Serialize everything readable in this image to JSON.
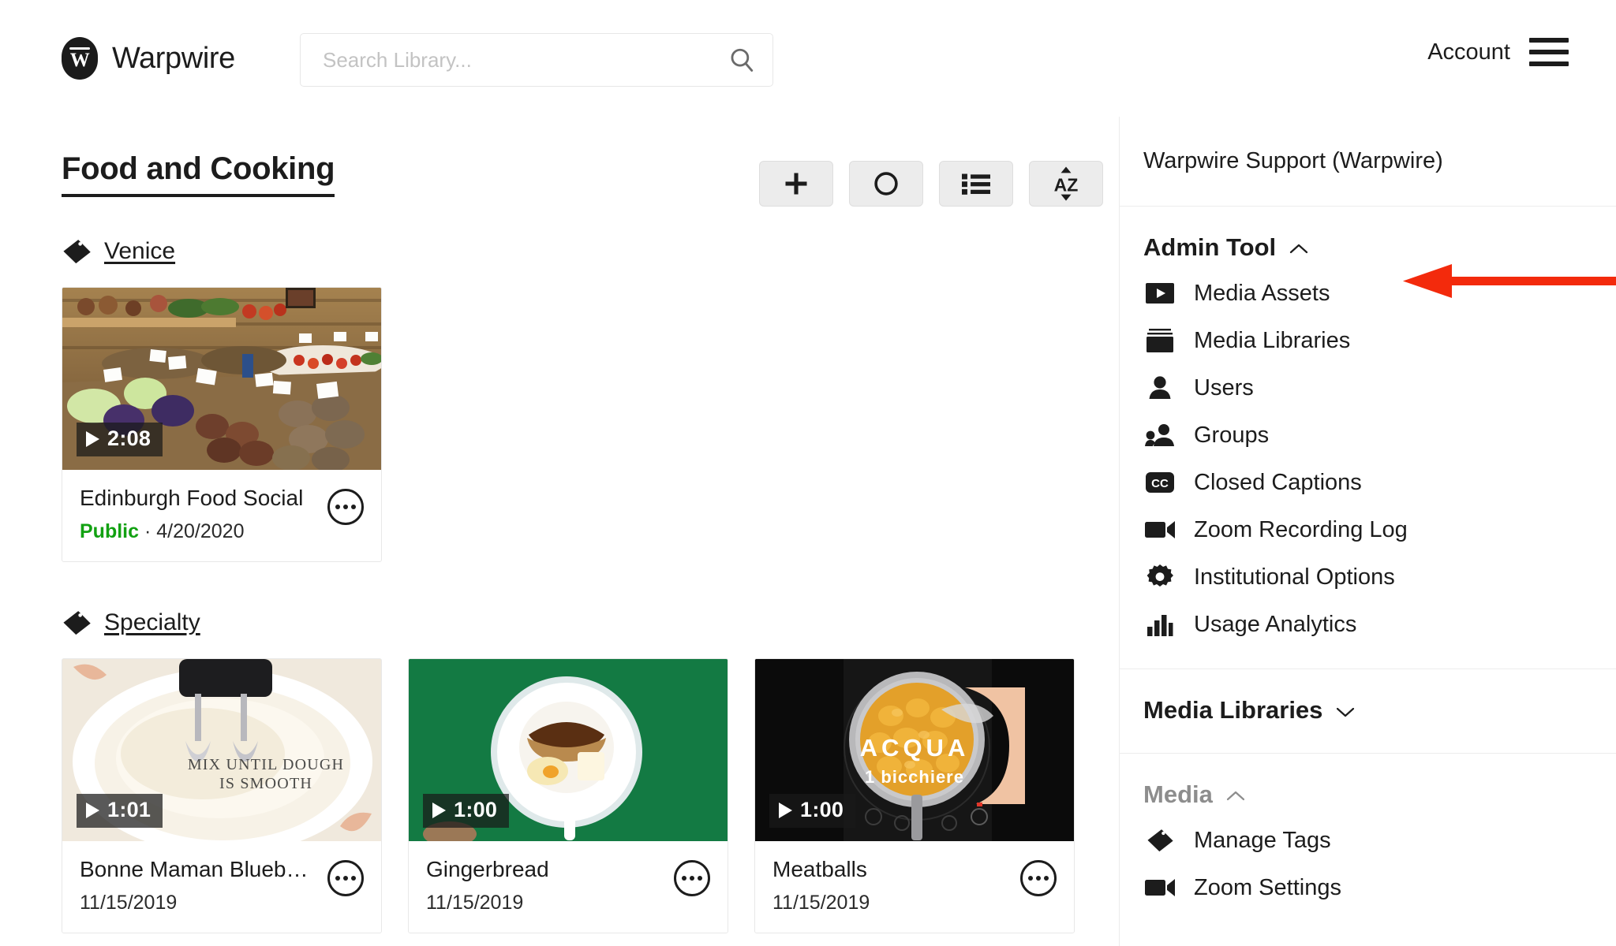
{
  "header": {
    "brand_name": "Warpwire",
    "brand_mark": "W",
    "search": {
      "value": "",
      "placeholder": "Search Library..."
    },
    "account_label": "Account",
    "icons": {
      "search": "search-icon",
      "menu": "hamburger-menu-icon"
    }
  },
  "main": {
    "page_title": "Food and Cooking",
    "toolbar": [
      {
        "name": "add-button",
        "icon": "plus-icon",
        "label": "+"
      },
      {
        "name": "record-button",
        "icon": "circle-icon",
        "label": "O"
      },
      {
        "name": "list-view-button",
        "icon": "list-icon",
        "label": "List"
      },
      {
        "name": "sort-button",
        "icon": "sort-az-icon",
        "label": "AZ"
      }
    ],
    "sections": [
      {
        "tag": "Venice",
        "tag_icon": "tag-icon",
        "cards": [
          {
            "title": "Edinburgh Food Social",
            "duration": "2:08",
            "visibility": "Public",
            "separator": "·",
            "date": "4/20/2020",
            "thumb": "market-produce",
            "overlay": "",
            "menu_icon": "more-options-icon"
          }
        ]
      },
      {
        "tag": "Specialty",
        "tag_icon": "tag-icon",
        "cards": [
          {
            "title": "Bonne Maman Blueb…",
            "duration": "1:01",
            "visibility": "",
            "separator": "",
            "date": "11/15/2019",
            "thumb": "mixer-bowl",
            "overlay": "MIX UNTIL DOUGH\nIS SMOOTH",
            "menu_icon": "more-options-icon"
          },
          {
            "title": "Gingerbread",
            "duration": "1:00",
            "visibility": "",
            "separator": "",
            "date": "11/15/2019",
            "thumb": "green-bowl",
            "overlay": "",
            "menu_icon": "more-options-icon"
          },
          {
            "title": "Meatballs",
            "duration": "1:00",
            "visibility": "",
            "separator": "",
            "date": "11/15/2019",
            "thumb": "pan-tomatoes",
            "overlay_line1": "ACQUA",
            "overlay_line2": "1 bicchiere",
            "menu_icon": "more-options-icon"
          }
        ]
      }
    ]
  },
  "sidebar": {
    "user": "Warpwire Support (Warpwire)",
    "sections": [
      {
        "title": "Admin Tool",
        "expanded": true,
        "chevron": "chevron-up-icon",
        "muted": false,
        "items": [
          {
            "label": "Media Assets",
            "icon": "video-play-icon"
          },
          {
            "label": "Media Libraries",
            "icon": "library-stack-icon"
          },
          {
            "label": "Users",
            "icon": "user-icon"
          },
          {
            "label": "Groups",
            "icon": "group-icon"
          },
          {
            "label": "Closed Captions",
            "icon": "closed-captions-icon"
          },
          {
            "label": "Zoom Recording Log",
            "icon": "video-camera-icon"
          },
          {
            "label": "Institutional Options",
            "icon": "gear-icon"
          },
          {
            "label": "Usage Analytics",
            "icon": "bar-chart-icon"
          }
        ]
      },
      {
        "title": "Media Libraries",
        "expanded": false,
        "chevron": "chevron-down-icon",
        "muted": false,
        "items": []
      },
      {
        "title": "Media",
        "expanded": true,
        "chevron": "chevron-up-icon",
        "muted": true,
        "items": [
          {
            "label": "Manage Tags",
            "icon": "tag-icon"
          },
          {
            "label": "Zoom Settings",
            "icon": "video-camera-icon"
          }
        ]
      }
    ]
  },
  "annotation": {
    "arrow_color": "#F32A0C",
    "points_to": "Admin Tool"
  }
}
